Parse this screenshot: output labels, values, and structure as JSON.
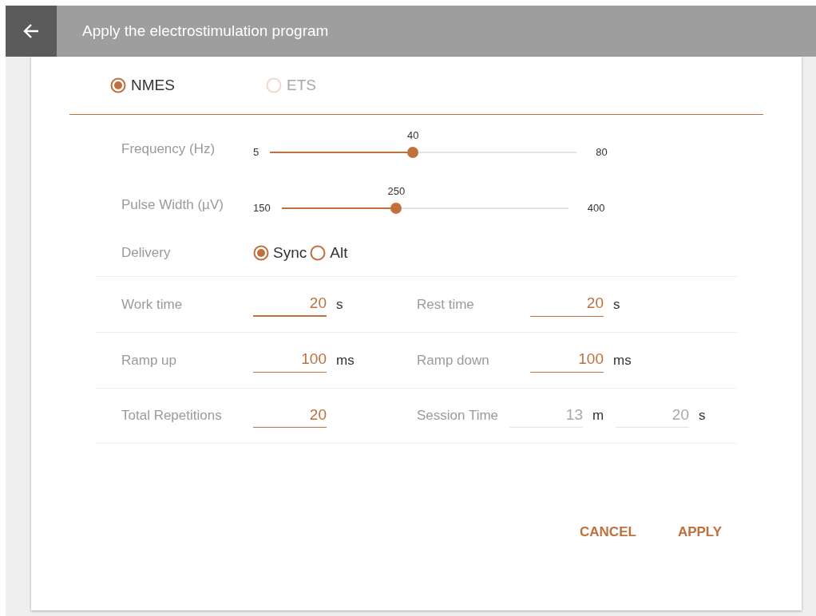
{
  "header": {
    "title": "Apply the electrostimulation program"
  },
  "modes": [
    {
      "label": "NMES",
      "selected": true,
      "disabled": false
    },
    {
      "label": "ETS",
      "selected": false,
      "disabled": true
    }
  ],
  "sliders": [
    {
      "label": "Frequency (Hz)",
      "min": "5",
      "max": "80",
      "value": "40",
      "level": 0.466
    },
    {
      "label": "Pulse Width (µV)",
      "min": "150",
      "max": "400",
      "value": "250",
      "level": 0.4
    }
  ],
  "delivery": {
    "label": "Delivery",
    "options": [
      {
        "label": "Sync",
        "selected": true
      },
      {
        "label": "Alt",
        "selected": false
      }
    ]
  },
  "rows": [
    [
      {
        "label": "Work time",
        "fields": [
          {
            "value": "20",
            "unit": "s",
            "focused": true,
            "disabled": false
          }
        ]
      },
      {
        "label": "Rest time",
        "fields": [
          {
            "value": "20",
            "unit": "s",
            "focused": false,
            "disabled": false
          }
        ]
      }
    ],
    [
      {
        "label": "Ramp up",
        "fields": [
          {
            "value": "100",
            "unit": "ms",
            "focused": false,
            "disabled": false
          }
        ]
      },
      {
        "label": "Ramp down",
        "fields": [
          {
            "value": "100",
            "unit": "ms",
            "focused": false,
            "disabled": false
          }
        ]
      }
    ],
    [
      {
        "label": "Total Repetitions",
        "fields": [
          {
            "value": "20",
            "focused": false,
            "disabled": false
          }
        ]
      },
      {
        "label": "Session Time",
        "fields": [
          {
            "value": "13",
            "unit": "m",
            "focused": false,
            "disabled": true
          },
          {
            "value": "20",
            "unit": "s",
            "focused": false,
            "disabled": true
          }
        ]
      }
    ]
  ],
  "buttons": [
    "CANCEL",
    "APPLY"
  ]
}
